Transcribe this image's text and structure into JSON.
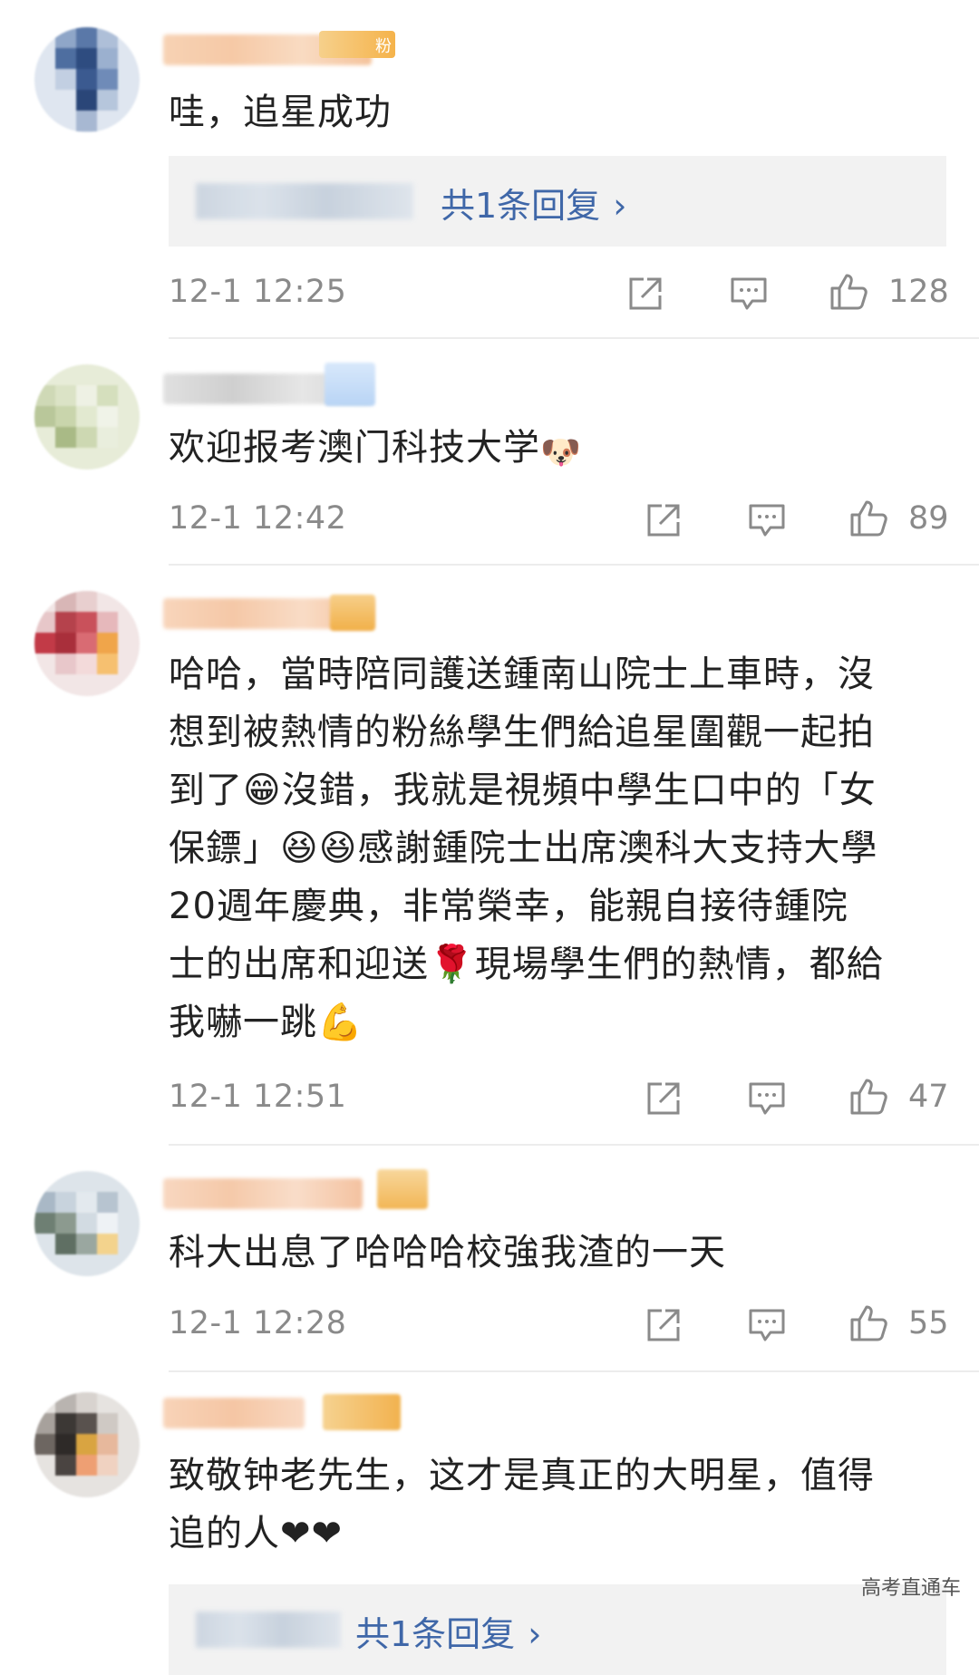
{
  "comments": [
    {
      "text": "哇，追星成功",
      "badge": "粉",
      "reply_link": "共1条回复",
      "time": "12-1 12:25",
      "likes": "128"
    },
    {
      "text": "欢迎报考澳门科技大学",
      "time": "12-1 12:42",
      "likes": "89",
      "emoji": "🐶"
    },
    {
      "lines": [
        "哈哈，當時陪同護送鍾南山院士上車時，沒",
        "想到被熱情的粉絲學生們給追星圍觀一起拍",
        "到了😁沒錯，我就是視頻中學生口中的「女",
        "保鏢」😆😆感謝鍾院士出席澳科大支持大學",
        "20週年慶典，非常榮幸，能親自接待鍾院",
        "士的出席和迎送🌹現場學生們的熱情，都給",
        "我嚇一跳💪"
      ],
      "time": "12-1 12:51",
      "likes": "47"
    },
    {
      "text": "科大出息了哈哈哈校強我渣的一天",
      "time": "12-1 12:28",
      "likes": "55"
    },
    {
      "lines": [
        "致敬钟老先生，这才是真正的大明星，值得",
        "追的人❤❤"
      ],
      "reply_link": "共1条回复"
    }
  ],
  "watermark": "高考直通车",
  "colors": {
    "link": "#3f67a8",
    "meta": "#8a8a8a",
    "reply_bg": "#f2f2f2"
  },
  "icons": {
    "share": "share-icon",
    "comment": "comment-icon",
    "like": "thumbs-up-icon"
  }
}
